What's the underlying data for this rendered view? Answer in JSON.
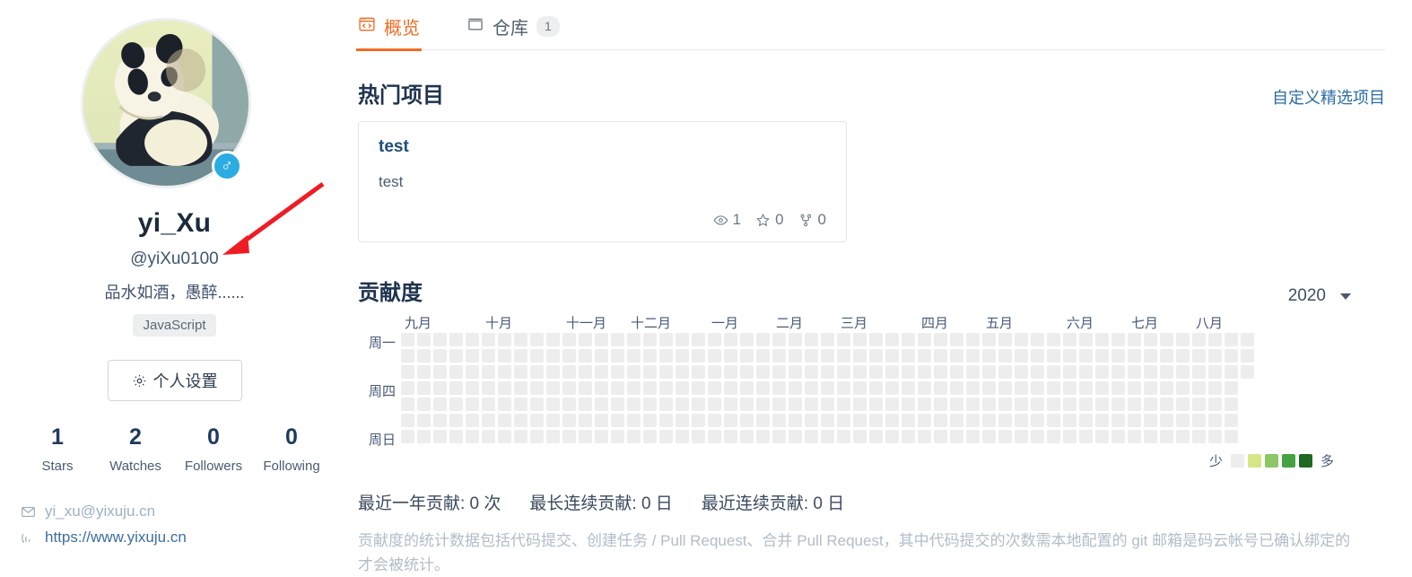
{
  "profile": {
    "avatar_alt": "panda-avatar",
    "gender_icon": "male-icon",
    "name": "yi_Xu",
    "handle": "@yiXu0100",
    "bio": "品水如酒，愚醉......",
    "language_tag": "JavaScript",
    "settings_button": "个人设置",
    "stats": [
      {
        "value": "1",
        "label": "Stars"
      },
      {
        "value": "2",
        "label": "Watches"
      },
      {
        "value": "0",
        "label": "Followers"
      },
      {
        "value": "0",
        "label": "Following"
      }
    ],
    "email": "yi_xu@yixuju.cn",
    "website": "https://www.yixuju.cn"
  },
  "tabs": [
    {
      "label": "概览",
      "icon": "code-browser-icon",
      "active": true,
      "badge": ""
    },
    {
      "label": "仓库",
      "icon": "repo-icon",
      "active": false,
      "badge": "1"
    }
  ],
  "popular": {
    "title": "热门项目",
    "customize_link": "自定义精选项目",
    "repos": [
      {
        "name": "test",
        "description": "test",
        "watches": "1",
        "stars": "0",
        "forks": "0"
      }
    ]
  },
  "contributions": {
    "title": "贡献度",
    "year": "2020",
    "months": [
      "九月",
      "十月",
      "十一月",
      "十二月",
      "一月",
      "二月",
      "三月",
      "四月",
      "五月",
      "六月",
      "七月",
      "八月"
    ],
    "weekdays": [
      "周一",
      "周四",
      "周日"
    ],
    "legend_less": "少",
    "legend_more": "多",
    "legend_colors": [
      "#ededed",
      "#d6e685",
      "#8cc665",
      "#44a340",
      "#1e6823"
    ],
    "stats": [
      "最近一年贡献: 0 次",
      "最长连续贡献: 0 日",
      "最近连续贡献: 0 日"
    ],
    "note": "贡献度的统计数据包括代码提交、创建任务 / Pull Request、合并 Pull Request，其中代码提交的次数需本地配置的 git 邮箱是码云帐号已确认绑定的才会被统计。",
    "total_columns": 53,
    "last_column_rows": 3,
    "cell_color": "#ededed"
  },
  "colors": {
    "accent": "#f26b23",
    "link": "#2b6ca3",
    "arrow": "#ee1c25"
  }
}
